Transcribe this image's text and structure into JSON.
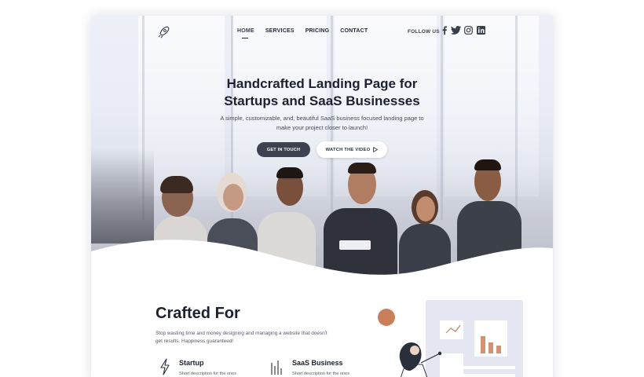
{
  "nav": {
    "links": [
      {
        "label": "HOME",
        "active": true
      },
      {
        "label": "SERVICES",
        "active": false
      },
      {
        "label": "PRICING",
        "active": false
      },
      {
        "label": "CONTACT",
        "active": false
      }
    ],
    "follow_label": "FOLLOW US",
    "social_icons": [
      "facebook-icon",
      "twitter-icon",
      "instagram-icon",
      "linkedin-icon"
    ]
  },
  "hero": {
    "title_line1": "Handcrafted Landing Page for",
    "title_line2": "Startups and SaaS Businesses",
    "subtitle": "A simple, customizable, and, beautiful SaaS business focused landing page to make your project closer to launch!",
    "primary_button": "GET IN TOUCH",
    "secondary_button": "WATCH THE VIDEO"
  },
  "crafted": {
    "title": "Crafted For",
    "subtitle": "Stop wasting time and money designing and managing a website that doesn't get results. Happiness guaranteed!",
    "features": [
      {
        "title": "Startup",
        "desc": "Short description for the ones",
        "icon": "lightning-icon"
      },
      {
        "title": "SaaS Business",
        "desc": "Short description for the ones",
        "icon": "bar-chart-icon"
      }
    ]
  },
  "colors": {
    "primary_dark": "#3d4150",
    "accent_orange": "#c9805a",
    "text_dark": "#1c2030"
  }
}
